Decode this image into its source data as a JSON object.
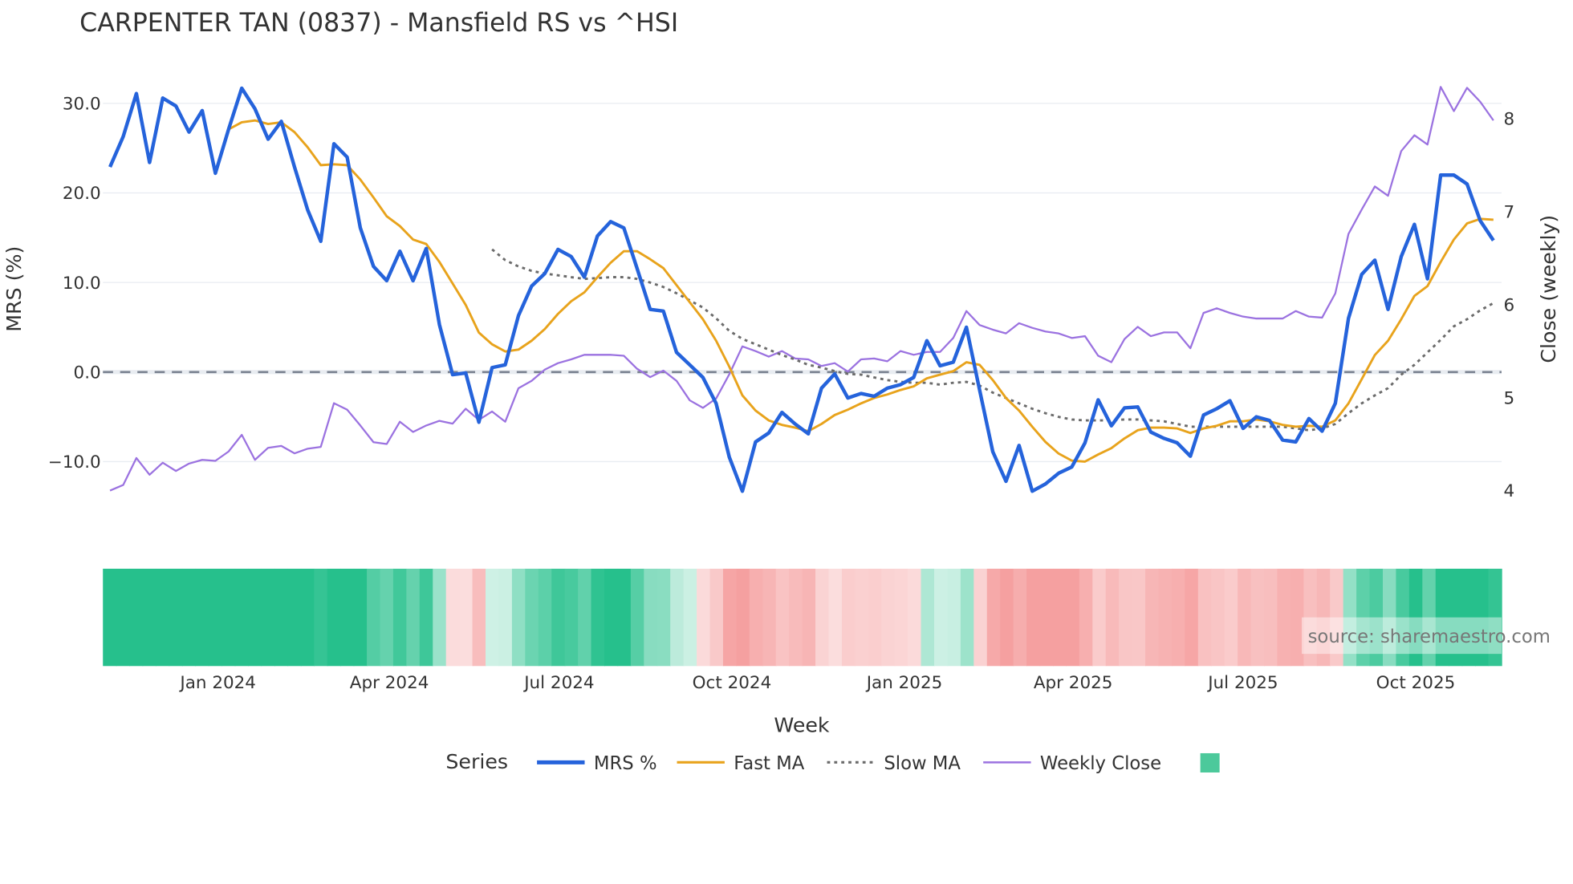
{
  "chart_data": {
    "type": "line",
    "title": "CARPENTER TAN (0837) - Mansfield RS vs ^HSI",
    "xlabel": "Week",
    "ylabel": "MRS (%)",
    "y2label": "Close (weekly)",
    "ylim": [
      -15,
      33
    ],
    "y2lim": [
      3.8,
      8.55
    ],
    "yticks": [
      30.0,
      20.0,
      10.0,
      0.0,
      -10.0
    ],
    "ytick_labels": [
      "30.0",
      "20.0",
      "10.0",
      "0.0",
      "−10.0"
    ],
    "y2ticks": [
      8,
      7,
      6,
      5,
      4
    ],
    "y2tick_labels": [
      "8",
      "7",
      "6",
      "5",
      "4"
    ],
    "xtick_labels": [
      "Jan 2024",
      "Apr 2024",
      "Jul 2024",
      "Oct 2024",
      "Jan 2025",
      "Apr 2025",
      "Jul 2025",
      "Oct 2025"
    ],
    "x_range": "2023-11-06 to 2025-11-03 (weekly)",
    "grid": true,
    "zero_line": 0,
    "legend_title": "Series",
    "legend_placement": "bottom-center",
    "source_text": "source: sharemaestro.com",
    "series": [
      {
        "name": "MRS %",
        "color": "#2563db",
        "style": "solid",
        "axis": "left",
        "values": [
          22.9,
          26.3,
          31.1,
          23.4,
          30.6,
          29.7,
          26.8,
          29.2,
          22.2,
          27.1,
          31.7,
          29.4,
          26.0,
          28.0,
          22.9,
          18.1,
          14.6,
          25.5,
          24.0,
          16.1,
          11.8,
          10.2,
          13.5,
          10.2,
          13.8,
          5.3,
          -0.3,
          -0.1,
          -5.6,
          0.5,
          0.8,
          6.3,
          9.6,
          11.0,
          13.7,
          12.9,
          10.6,
          15.2,
          16.8,
          16.1,
          11.6,
          7.0,
          6.8,
          2.2,
          0.8,
          -0.6,
          -3.5,
          -9.5,
          -13.3,
          -7.8,
          -6.8,
          -4.5,
          -5.8,
          -6.9,
          -1.8,
          -0.2,
          -2.9,
          -2.4,
          -2.7,
          -1.8,
          -1.4,
          -0.6,
          3.5,
          0.7,
          1.1,
          5.0,
          -2.0,
          -8.9,
          -12.2,
          -8.2,
          -13.3,
          -12.5,
          -11.3,
          -10.6,
          -7.9,
          -3.1,
          -6.0,
          -4.0,
          -3.9,
          -6.7,
          -7.4,
          -7.9,
          -9.4,
          -4.8,
          -4.1,
          -3.2,
          -6.3,
          -5.0,
          -5.4,
          -7.6,
          -7.8,
          -5.2,
          -6.6,
          -3.5,
          6.0,
          10.9,
          12.5,
          7.0,
          12.9,
          16.5,
          10.4,
          22.0,
          22.0,
          21.0,
          16.9,
          14.7
        ]
      },
      {
        "name": "Fast MA",
        "color": "#e8a31c",
        "style": "solid",
        "axis": "left",
        "values": [
          27.1,
          27.9,
          28.1,
          27.7,
          27.9,
          26.8,
          25.1,
          23.1,
          23.2,
          23.1,
          21.5,
          19.5,
          17.4,
          16.3,
          14.8,
          14.3,
          12.3,
          9.9,
          7.5,
          4.4,
          3.1,
          2.3,
          2.5,
          3.5,
          4.8,
          6.5,
          7.9,
          8.9,
          10.6,
          12.2,
          13.5,
          13.5,
          12.6,
          11.6,
          9.7,
          7.8,
          5.9,
          3.5,
          0.6,
          -2.6,
          -4.3,
          -5.4,
          -5.9,
          -6.2,
          -6.6,
          -5.8,
          -4.8,
          -4.2,
          -3.5,
          -2.9,
          -2.5,
          -2.0,
          -1.6,
          -0.7,
          -0.3,
          0.1,
          1.1,
          0.8,
          -0.9,
          -2.9,
          -4.3,
          -6.1,
          -7.8,
          -9.1,
          -9.9,
          -10.0,
          -9.2,
          -8.5,
          -7.4,
          -6.5,
          -6.2,
          -6.2,
          -6.3,
          -6.8,
          -6.3,
          -6.0,
          -5.5,
          -5.5,
          -5.3,
          -5.5,
          -5.9,
          -6.1,
          -6.0,
          -6.1,
          -5.4,
          -3.5,
          -0.8,
          1.9,
          3.5,
          5.9,
          8.5,
          9.6,
          12.3,
          14.8,
          16.6,
          17.1,
          17.0
        ]
      },
      {
        "name": "Slow MA",
        "color": "#6b6b6b",
        "style": "dotted",
        "axis": "left",
        "values": [
          13.7,
          12.5,
          11.8,
          11.3,
          11.0,
          10.8,
          10.6,
          10.4,
          10.5,
          10.6,
          10.6,
          10.4,
          10.0,
          9.5,
          8.8,
          8.0,
          7.2,
          6.0,
          4.6,
          3.7,
          3.1,
          2.5,
          1.9,
          1.4,
          0.8,
          0.5,
          0.1,
          -0.2,
          -0.3,
          -0.6,
          -0.9,
          -1.1,
          -1.2,
          -1.2,
          -1.4,
          -1.2,
          -1.1,
          -1.5,
          -2.3,
          -2.9,
          -3.5,
          -4.1,
          -4.6,
          -5.0,
          -5.3,
          -5.4,
          -5.4,
          -5.4,
          -5.3,
          -5.3,
          -5.4,
          -5.5,
          -5.8,
          -6.1,
          -6.1,
          -6.1,
          -6.1,
          -6.1,
          -6.1,
          -6.1,
          -6.1,
          -6.3,
          -6.5,
          -6.3,
          -5.8,
          -4.6,
          -3.5,
          -2.6,
          -1.8,
          -0.3,
          0.8,
          2.2,
          3.6,
          5.1,
          5.9,
          6.9,
          7.7
        ]
      },
      {
        "name": "Weekly Close",
        "color": "#9b72e0",
        "style": "solid",
        "axis": "right",
        "values": [
          3.99,
          4.05,
          4.34,
          4.16,
          4.29,
          4.2,
          4.28,
          4.32,
          4.31,
          4.41,
          4.59,
          4.32,
          4.45,
          4.47,
          4.39,
          4.44,
          4.46,
          4.93,
          4.86,
          4.69,
          4.51,
          4.49,
          4.73,
          4.62,
          4.69,
          4.74,
          4.71,
          4.87,
          4.75,
          4.84,
          4.73,
          5.09,
          5.17,
          5.29,
          5.36,
          5.4,
          5.45,
          5.45,
          5.45,
          5.44,
          5.3,
          5.21,
          5.28,
          5.17,
          4.96,
          4.88,
          4.98,
          5.24,
          5.54,
          5.49,
          5.43,
          5.49,
          5.41,
          5.4,
          5.33,
          5.36,
          5.27,
          5.4,
          5.41,
          5.38,
          5.49,
          5.45,
          5.48,
          5.48,
          5.63,
          5.92,
          5.77,
          5.72,
          5.68,
          5.79,
          5.74,
          5.7,
          5.68,
          5.63,
          5.65,
          5.44,
          5.37,
          5.62,
          5.75,
          5.65,
          5.69,
          5.69,
          5.52,
          5.9,
          5.95,
          5.9,
          5.86,
          5.84,
          5.84,
          5.84,
          5.92,
          5.86,
          5.85,
          6.11,
          6.75,
          7.01,
          7.26,
          7.16,
          7.64,
          7.81,
          7.71,
          8.33,
          8.07,
          8.32,
          8.17,
          7.97
        ]
      }
    ],
    "heatmap": {
      "positive_color": "#26c08c",
      "negative_color": "#f5a0a0",
      "legend_swatch_color": "#4cc99b"
    }
  }
}
